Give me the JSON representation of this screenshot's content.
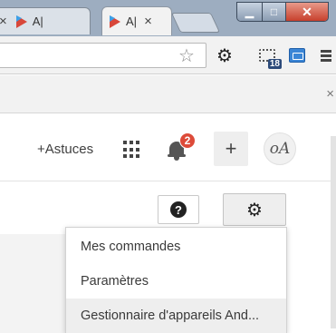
{
  "browser": {
    "tabs": [
      {
        "title": "A|",
        "active": false
      },
      {
        "title": "A|",
        "active": true
      }
    ],
    "tab_close_glyph": "×",
    "window_buttons": {
      "minimize": "▁",
      "maximize": "□",
      "close": "✕"
    }
  },
  "toolbar": {
    "extension_badge": "18"
  },
  "header": {
    "astuces_label": "+Astuces",
    "notification_count": "2",
    "plus_label": "+",
    "avatar_text": "oA"
  },
  "actions": {
    "help_glyph": "?",
    "settings_glyph": "⚙"
  },
  "settings_menu": {
    "items": [
      {
        "label": "Mes commandes"
      },
      {
        "label": "Paramètres"
      },
      {
        "label": "Gestionnaire d'appareils And..."
      }
    ],
    "highlighted_index": 2
  },
  "colors": {
    "accent_red": "#dd4b39",
    "titlebar": "#9dadc0"
  }
}
